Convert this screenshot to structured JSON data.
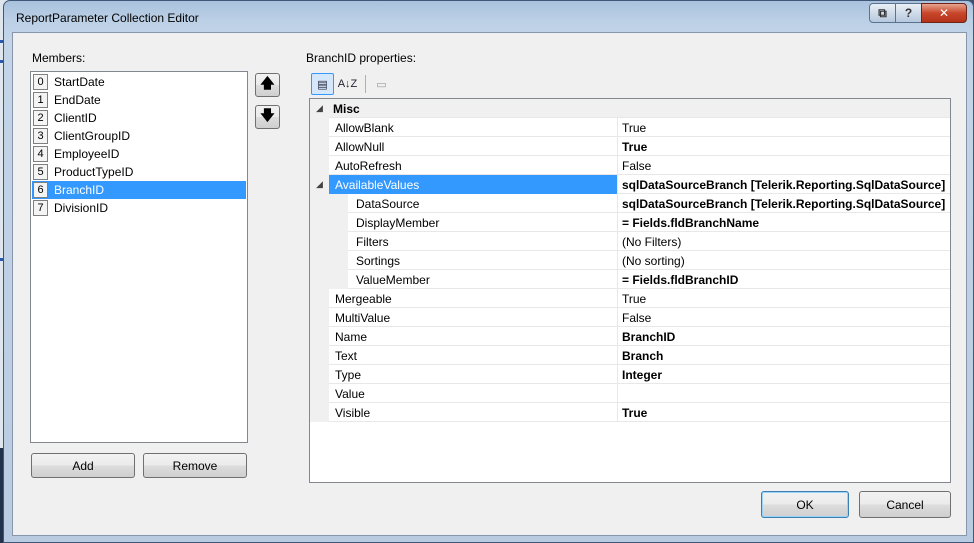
{
  "window": {
    "title": "ReportParameter Collection Editor",
    "caption": {
      "restore": "⧉",
      "help": "?",
      "close": "✕"
    }
  },
  "members": {
    "label": "Members:",
    "items": [
      {
        "index": "0",
        "label": "StartDate"
      },
      {
        "index": "1",
        "label": "EndDate"
      },
      {
        "index": "2",
        "label": "ClientID"
      },
      {
        "index": "3",
        "label": "ClientGroupID"
      },
      {
        "index": "4",
        "label": "EmployeeID"
      },
      {
        "index": "5",
        "label": "ProductTypeID"
      },
      {
        "index": "6",
        "label": "BranchID"
      },
      {
        "index": "7",
        "label": "DivisionID"
      }
    ],
    "selected_index": 6,
    "add_label": "Add",
    "remove_label": "Remove",
    "up_glyph": "🡅",
    "down_glyph": "🡇"
  },
  "properties": {
    "label": "BranchID properties:",
    "toolbar": {
      "categorized": "▤",
      "alphabetical": "A↓Z",
      "pages": "▭"
    },
    "category": {
      "toggle": "◢",
      "name": "Misc"
    },
    "rows": [
      {
        "name": "AllowBlank",
        "value": "True",
        "bold": false,
        "child": false
      },
      {
        "name": "AllowNull",
        "value": "True",
        "bold": true,
        "child": false
      },
      {
        "name": "AutoRefresh",
        "value": "False",
        "bold": false,
        "child": false
      },
      {
        "name": "AvailableValues",
        "value": "sqlDataSourceBranch [Telerik.Reporting.SqlDataSource]",
        "bold": true,
        "child": false,
        "expander": "◢",
        "selected": true
      },
      {
        "name": "DataSource",
        "value": "sqlDataSourceBranch [Telerik.Reporting.SqlDataSource]",
        "bold": true,
        "child": true
      },
      {
        "name": "DisplayMember",
        "value": "= Fields.fldBranchName",
        "bold": true,
        "child": true
      },
      {
        "name": "Filters",
        "value": "(No Filters)",
        "bold": false,
        "child": true
      },
      {
        "name": "Sortings",
        "value": "(No sorting)",
        "bold": false,
        "child": true
      },
      {
        "name": "ValueMember",
        "value": "= Fields.fldBranchID",
        "bold": true,
        "child": true
      },
      {
        "name": "Mergeable",
        "value": "True",
        "bold": false,
        "child": false
      },
      {
        "name": "MultiValue",
        "value": "False",
        "bold": false,
        "child": false
      },
      {
        "name": "Name",
        "value": "BranchID",
        "bold": true,
        "child": false
      },
      {
        "name": "Text",
        "value": "Branch",
        "bold": true,
        "child": false
      },
      {
        "name": "Type",
        "value": "Integer",
        "bold": true,
        "child": false
      },
      {
        "name": "Value",
        "value": "",
        "bold": false,
        "child": false
      },
      {
        "name": "Visible",
        "value": "True",
        "bold": true,
        "child": false
      }
    ]
  },
  "footer": {
    "ok_label": "OK",
    "cancel_label": "Cancel"
  },
  "colors": {
    "selection": "#3399ff",
    "close": "#c8472b"
  }
}
